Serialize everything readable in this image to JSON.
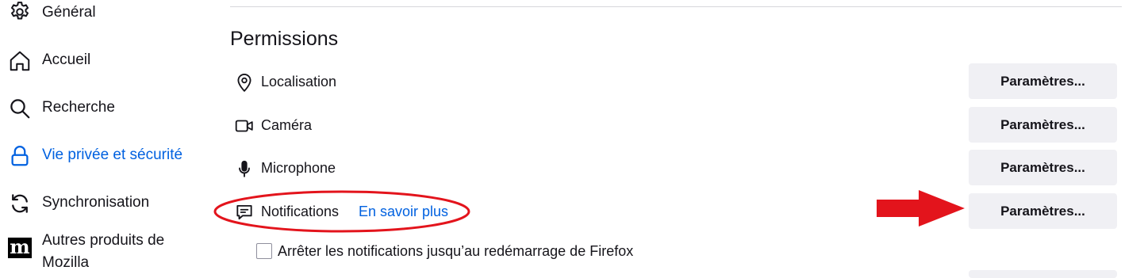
{
  "sidebar": {
    "items": [
      {
        "label": "Général",
        "icon": "gear-icon"
      },
      {
        "label": "Accueil",
        "icon": "home-icon"
      },
      {
        "label": "Recherche",
        "icon": "search-icon"
      },
      {
        "label": "Vie privée et sécurité",
        "icon": "lock-icon",
        "active": true
      },
      {
        "label": "Synchronisation",
        "icon": "sync-icon"
      },
      {
        "label": "Autres produits de Mozilla",
        "icon": "mozilla-logo-icon",
        "logo_text": "m"
      }
    ]
  },
  "permissions": {
    "title": "Permissions",
    "rows": [
      {
        "label": "Localisation",
        "icon": "location-pin-icon",
        "button": "Paramètres..."
      },
      {
        "label": "Caméra",
        "icon": "camera-icon",
        "button": "Paramètres..."
      },
      {
        "label": "Microphone",
        "icon": "microphone-icon",
        "button": "Paramètres..."
      },
      {
        "label": "Notifications",
        "icon": "notification-icon",
        "link": "En savoir plus",
        "button": "Paramètres..."
      }
    ],
    "pause_notifications": {
      "label": "Arrêter les notifications jusqu’au redémarrage de Firefox",
      "checked": false
    }
  },
  "annotations": {
    "color": "#e3141c"
  },
  "colors": {
    "accent": "#0061e0",
    "button_bg": "#f0f0f4",
    "text": "#15141a"
  }
}
